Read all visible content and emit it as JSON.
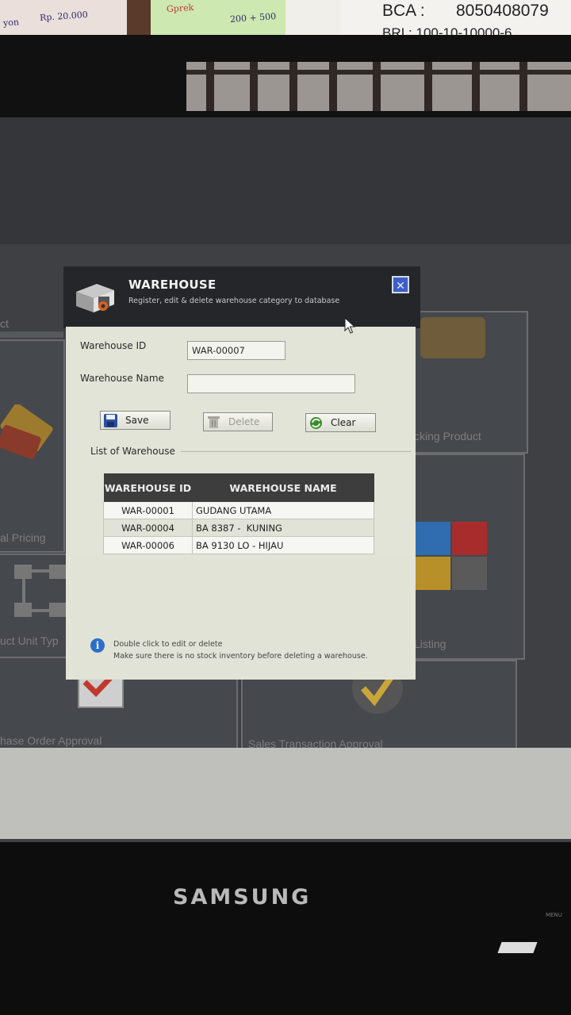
{
  "background": {
    "notes": [
      "yon",
      "Rp. 20.000",
      "Gprek",
      "200 + 500"
    ],
    "bank_line1_label": "BCA :",
    "bank_line1_number": "8050408079",
    "bank_line2": "BRI  :  100-10-10000-6",
    "monitor_brand": "SAMSUNG",
    "monitor_menu": "MENU"
  },
  "desktop_tiles": {
    "labels": [
      "ct",
      "al Pricing",
      "uct Unit Typ",
      "hase Order Approval",
      "Sales Transaction Approval",
      "cking Product",
      "Listing"
    ]
  },
  "dialog": {
    "title": "WAREHOUSE",
    "subtitle": "Register, edit & delete warehouse category to database",
    "close_icon": "close-icon",
    "fields": {
      "warehouse_id_label": "Warehouse ID",
      "warehouse_id_value": "WAR-00007",
      "warehouse_name_label": "Warehouse Name",
      "warehouse_name_value": ""
    },
    "buttons": {
      "save": "Save",
      "delete": "Delete",
      "clear": "Clear"
    },
    "list_label": "List of Warehouse",
    "table": {
      "headers": [
        "WAREHOUSE ID",
        "WAREHOUSE NAME"
      ],
      "rows": [
        {
          "id": "WAR-00001",
          "name": "GUDANG UTAMA"
        },
        {
          "id": "WAR-00004",
          "name": "BA 8387 -  KUNING"
        },
        {
          "id": "WAR-00006",
          "name": "BA 9130 LO - HIJAU"
        }
      ]
    },
    "info": {
      "line1": "Double click to edit or delete",
      "line2": "Make sure there is no stock inventory before deleting a warehouse."
    }
  },
  "colors": {
    "header_bg": "#252629",
    "body_bg": "#e3e4d8",
    "table_header_bg": "#3d3d3d",
    "close_button": "#3b5ec8"
  }
}
